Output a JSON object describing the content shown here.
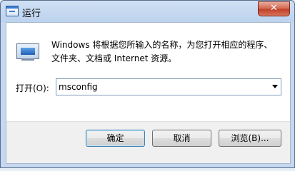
{
  "window": {
    "title": "运行",
    "close_label": "✕"
  },
  "content": {
    "description_line1": "Windows 将根据您所输入的名称，为您打开相应的程序、",
    "description_line2": "文件夹、文档或 Internet 资源。",
    "open_label": "打开(O):",
    "input_value": "msconfig"
  },
  "buttons": {
    "ok": "确定",
    "cancel": "取消",
    "browse": "浏览(B)..."
  }
}
